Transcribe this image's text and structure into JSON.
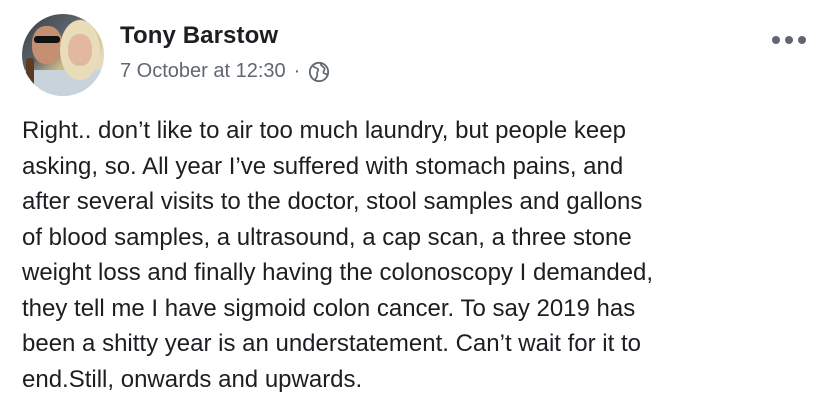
{
  "author": {
    "name": "Tony Barstow"
  },
  "post_meta": {
    "timestamp": "7 October at 12:30",
    "separator": "·",
    "privacy_icon": "globe-icon"
  },
  "menu": {
    "icon": "more-options-icon"
  },
  "post": {
    "text": "Right.. don’t like to air too much laundry, but people keep\nasking, so. All year I’ve suffered with stomach pains, and\nafter several visits to the doctor,  stool samples and gallons\nof blood samples, a ultrasound, a cap scan, a three stone\nweight loss and finally having the colonoscopy I demanded,\nthey tell me I have sigmoid colon cancer. To say 2019 has\nbeen a shitty year is an understatement. Can’t wait for it to\nend.Still, onwards and upwards."
  },
  "colors": {
    "name": "#1c1e21",
    "meta": "#606770",
    "background": "#ffffff"
  }
}
